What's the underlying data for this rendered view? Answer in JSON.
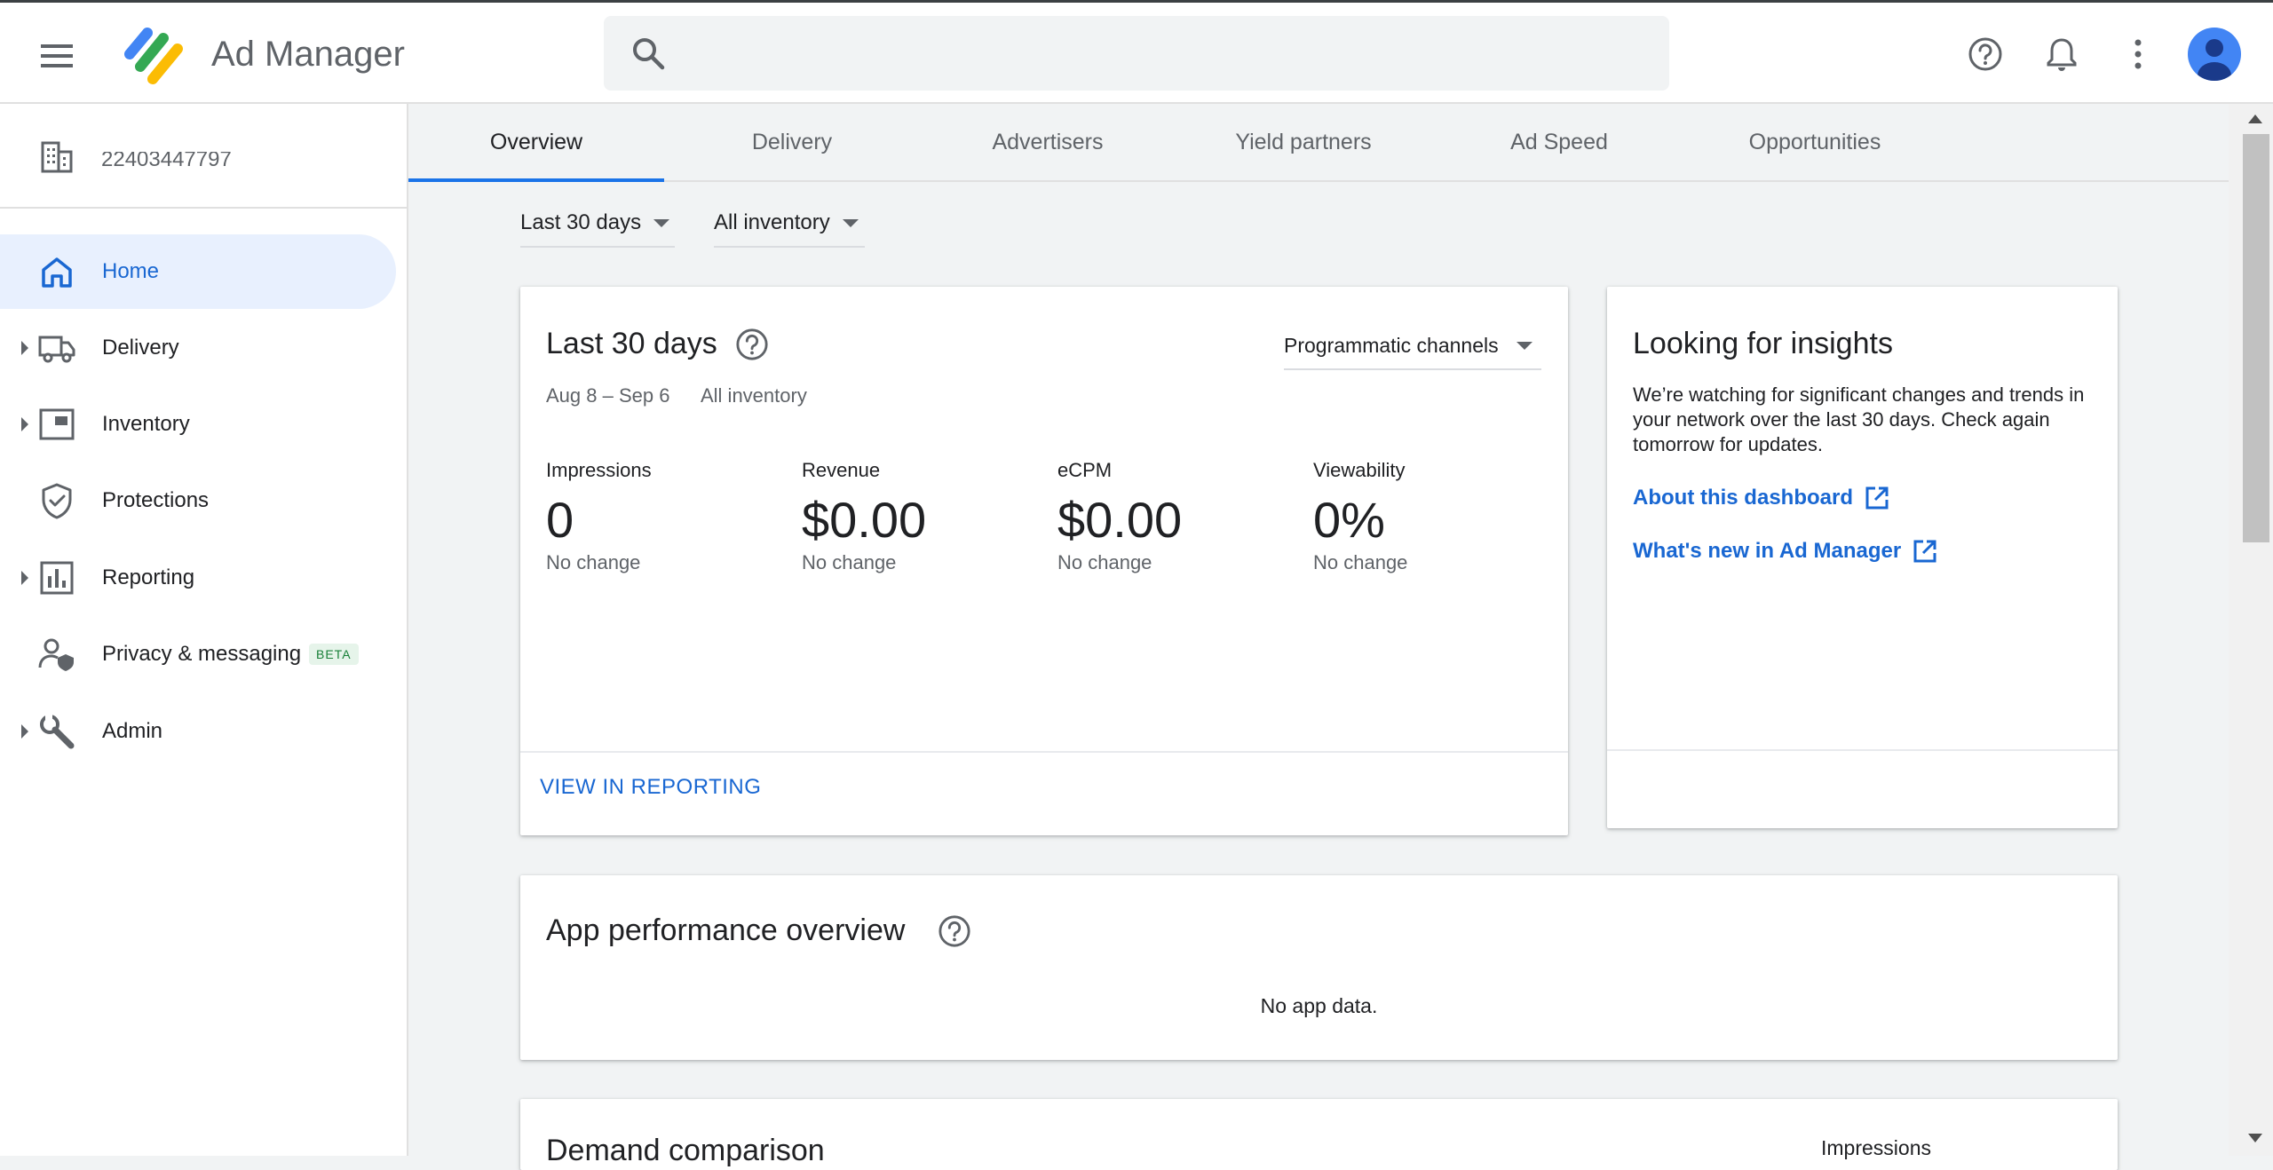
{
  "app": {
    "title": "Ad Manager"
  },
  "header": {
    "search_placeholder": "",
    "icons": [
      "menu-icon",
      "search-icon",
      "help-icon",
      "notifications-icon",
      "more-vert-icon",
      "account-icon"
    ]
  },
  "network": {
    "id": "22403447797"
  },
  "sidebar": {
    "items": [
      {
        "label": "Home",
        "icon": "home-icon",
        "active": true
      },
      {
        "label": "Delivery",
        "icon": "truck-icon"
      },
      {
        "label": "Inventory",
        "icon": "inventory-icon"
      },
      {
        "label": "Protections",
        "icon": "shield-icon"
      },
      {
        "label": "Reporting",
        "icon": "bar-chart-icon"
      },
      {
        "label": "Privacy & messaging",
        "icon": "privacy-icon",
        "badge": "BETA"
      },
      {
        "label": "Admin",
        "icon": "wrench-icon"
      }
    ]
  },
  "tabs": [
    {
      "label": "Overview",
      "active": true
    },
    {
      "label": "Delivery"
    },
    {
      "label": "Advertisers"
    },
    {
      "label": "Yield partners"
    },
    {
      "label": "Ad Speed"
    },
    {
      "label": "Opportunities"
    }
  ],
  "filters": {
    "date_range": "Last 30 days",
    "inventory": "All inventory"
  },
  "summary_card": {
    "title": "Last 30 days",
    "date_range": "Aug 8 – Sep 6",
    "inventory": "All inventory",
    "channel": "Programmatic channels",
    "metrics": [
      {
        "label": "Impressions",
        "value": "0",
        "change": "No change"
      },
      {
        "label": "Revenue",
        "value": "$0.00",
        "change": "No change"
      },
      {
        "label": "eCPM",
        "value": "$0.00",
        "change": "No change"
      },
      {
        "label": "Viewability",
        "value": "0%",
        "change": "No change"
      }
    ],
    "action": "VIEW IN REPORTING"
  },
  "insights_card": {
    "title": "Looking for insights",
    "text": "We’re watching for significant changes and trends in your network over the last 30 days. Check again tomorrow for updates.",
    "links": [
      "About this dashboard",
      "What's new in Ad Manager"
    ]
  },
  "app_card": {
    "title": "App performance overview",
    "empty": "No app data."
  },
  "demand_card": {
    "title": "Demand comparison",
    "metric": "Impressions"
  },
  "colors": {
    "accent": "#1a73e8",
    "link": "#1967d2",
    "active_bg": "#e8f0fe",
    "background": "#f1f3f4"
  }
}
